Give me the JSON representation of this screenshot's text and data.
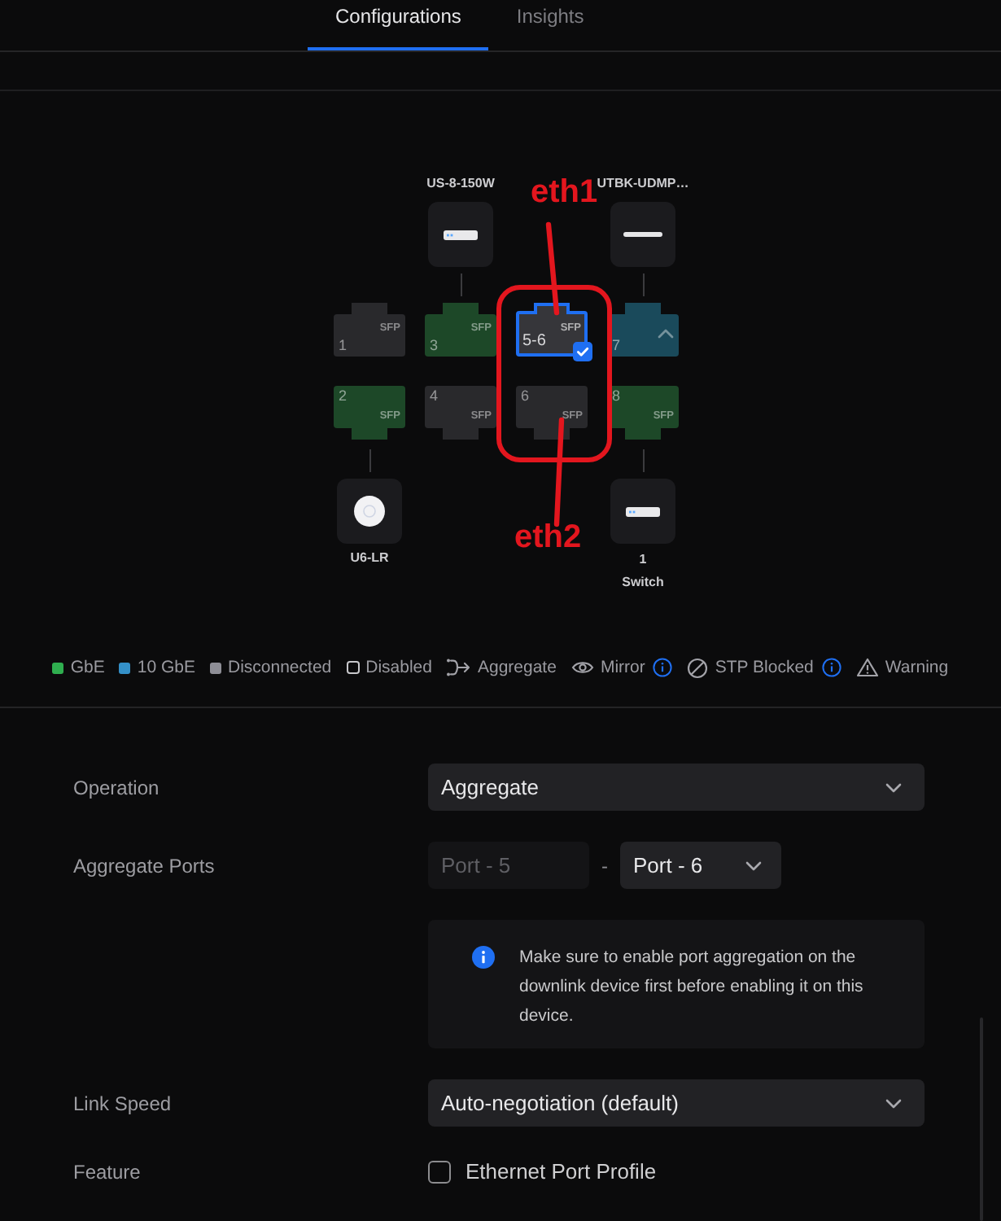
{
  "tabs": [
    {
      "label": "Configurations",
      "selected": true
    },
    {
      "label": "Insights",
      "selected": false
    }
  ],
  "port_diagram": {
    "columns": [
      {
        "top_port": {
          "number": "1",
          "kind": "disconnected",
          "tag": "SFP",
          "uplink": false,
          "selected": false
        },
        "bottom_port": {
          "number": "2",
          "kind": "gigabit",
          "tag": "SFP",
          "uplink": false,
          "selected": false,
          "device": {
            "kind": "access_point",
            "labels": [
              "U6-LR"
            ]
          }
        }
      },
      {
        "top_port": {
          "number": "3",
          "kind": "gigabit",
          "tag": "SFP",
          "uplink": false,
          "selected": false,
          "device": {
            "kind": "switch",
            "labels": [
              "US-8-150W"
            ]
          }
        },
        "bottom_port": {
          "number": "4",
          "kind": "disconnected",
          "tag": "SFP",
          "uplink": false,
          "selected": false
        }
      },
      {
        "top_port": {
          "number": "5-6",
          "kind": "disconnected",
          "tag": "SFP",
          "uplink": false,
          "selected": true
        },
        "bottom_port": {
          "number": "6",
          "kind": "disconnected",
          "tag": "SFP",
          "uplink": false,
          "selected": false
        }
      },
      {
        "top_port": {
          "number": "7",
          "kind": "tengigabit",
          "uplink": true,
          "selected": false,
          "device": {
            "kind": "gateway",
            "labels": [
              "UTBK-UDMP…"
            ]
          }
        },
        "bottom_port": {
          "number": "8",
          "kind": "gigabit",
          "tag": "SFP",
          "uplink": false,
          "selected": false,
          "device": {
            "kind": "switch",
            "labels": [
              "1",
              "Switch"
            ]
          }
        }
      }
    ]
  },
  "legend": [
    {
      "kind": "swatch",
      "label": "GbE",
      "color": "#2fae4f",
      "info": false
    },
    {
      "kind": "swatch",
      "label": "10 GbE",
      "color": "#3490c8",
      "info": false
    },
    {
      "kind": "swatch",
      "label": "Disconnected",
      "color": "#8e8e96",
      "info": false
    },
    {
      "kind": "outline",
      "label": "Disabled",
      "info": false
    },
    {
      "kind": "aggregate",
      "label": "Aggregate",
      "info": false
    },
    {
      "kind": "mirror",
      "label": "Mirror",
      "info": true
    },
    {
      "kind": "stp_blocked",
      "label": "STP Blocked",
      "info": true
    },
    {
      "kind": "warning",
      "label": "Warning",
      "info": false
    }
  ],
  "annotation": {
    "labels": [
      "eth1",
      "eth2"
    ]
  },
  "form": {
    "rows": [
      {
        "kind": "select",
        "label": "Operation",
        "value": "Aggregate"
      },
      {
        "kind": "port_range",
        "label": "Aggregate Ports",
        "from": {
          "value": "Port - 5",
          "disabled": true
        },
        "separator": "-",
        "to": {
          "value": "Port - 6",
          "disabled": false
        }
      },
      {
        "kind": "notice",
        "text": "Make sure to enable port aggregation on the downlink device first before enabling it on this device."
      },
      {
        "kind": "select",
        "label": "Link Speed",
        "value": "Auto-negotiation (default)"
      },
      {
        "kind": "checkbox",
        "label": "Feature",
        "option": "Ethernet Port Profile",
        "checked": false
      }
    ]
  }
}
